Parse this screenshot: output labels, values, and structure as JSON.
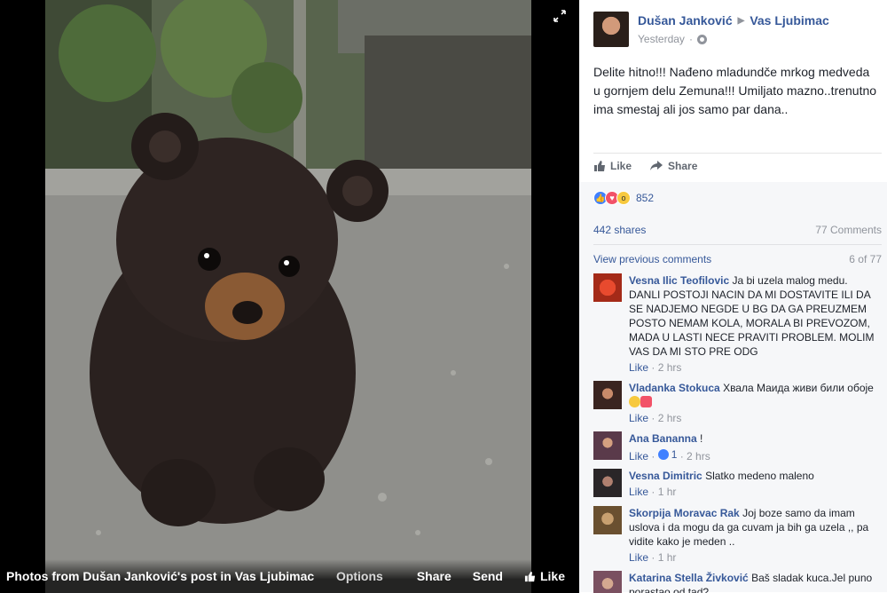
{
  "photo_viewer": {
    "caption": "Photos from Dušan Janković's post in Vas Ljubimac",
    "actions": {
      "options": "Options",
      "share": "Share",
      "send": "Send",
      "like": "Like"
    },
    "expand_icon": "expand-icon"
  },
  "post": {
    "author": "Dušan Janković",
    "target": "Vas Ljubimac",
    "time": "Yesterday",
    "privacy_icon": "globe-icon",
    "text": "Delite hitno!!! Nađeno mladundče mrkog medveda u gornjem delu Zemuna!!! Umiljato mazno..trenutno ima smestaj ali jos samo par dana..",
    "like_label": "Like",
    "share_label": "Share",
    "reactions_count": "852",
    "shares": "442 shares",
    "comments_count": "77 Comments",
    "view_previous": "View previous comments",
    "position": "6 of 77"
  },
  "comments": [
    {
      "name": "Vesna Ilic Teofilovic",
      "text": "Ja bi uzela malog medu. DANLI POSTOJI NACIN DA MI DOSTAVITE ILI DA SE NADJEMO NEGDE U BG DA GA PREUZMEM POSTO NEMAM KOLA, MORALA BI PREVOZOM, MADA U LASTI NECE PRAVITI PROBLEM. MOLIM VAS DA MI STO PRE ODG",
      "like": "Like",
      "time": "2 hrs"
    },
    {
      "name": "Vladanka Stokuca",
      "text": "Хвала Маида живи били обоје",
      "like": "Like",
      "time": "2 hrs"
    },
    {
      "name": "Ana Bananna",
      "text": "!",
      "like": "Like",
      "likes": "1",
      "time": "2 hrs"
    },
    {
      "name": "Vesna Dimitric",
      "text": "Slatko medeno maleno",
      "like": "Like",
      "time": "1 hr"
    },
    {
      "name": "Skorpija Moravac Rak",
      "text": "Joj boze samo da imam uslova i da mogu da ga cuvam ja bih ga uzela ,, pa vidite kako je meden ..",
      "like": "Like",
      "time": "1 hr"
    },
    {
      "name": "Katarina Stella Živković",
      "text": "Baš sladak kuca.Jel puno porastao od tad?"
    }
  ],
  "colors": {
    "link": "#365899",
    "muted": "#90949c",
    "like_blue": "#4080ff",
    "love_red": "#f25268",
    "wow_yellow": "#f7c93e"
  }
}
